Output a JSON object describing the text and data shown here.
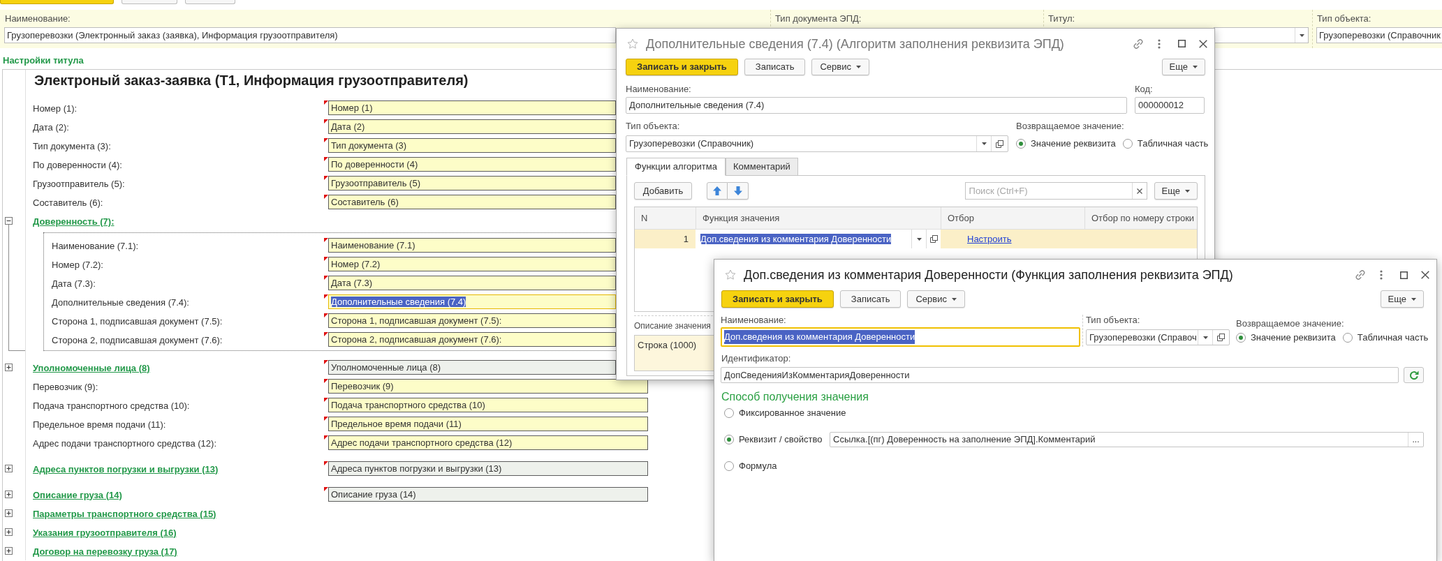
{
  "toolbar": {
    "buttons": [
      {
        "kind": "primary"
      },
      {
        "kind": "default"
      },
      {
        "kind": "default"
      }
    ]
  },
  "header": {
    "fields": [
      {
        "label": "Наименование:",
        "kind": "text",
        "value": "Грузоперевозки (Электронный заказ (заявка), Информация грузоотправителя)"
      },
      {
        "label": "Тип документа ЭПД:"
      },
      {
        "label": "Титул:",
        "kind": "dropdown"
      },
      {
        "label": "Тип объекта:",
        "kind": "text",
        "value": "Грузоперевозки (Справочник"
      }
    ]
  },
  "title_settings": {
    "title": "Настройки титула",
    "heading": "Электроный заказ-заявка (Т1, Информация грузоотправителя)",
    "rows": [
      {
        "kind": "field",
        "label": "Номер (1):",
        "value": "Номер (1)"
      },
      {
        "kind": "field",
        "label": "Дата (2):",
        "value": "Дата (2)"
      },
      {
        "kind": "field",
        "label": "Тип документа (3):",
        "value": "Тип документа (3)"
      },
      {
        "kind": "field",
        "label": "По доверенности (4):",
        "value": "По доверенности (4)"
      },
      {
        "kind": "field",
        "label": "Грузоотправитель (5):",
        "value": "Грузоотправитель (5)"
      },
      {
        "kind": "field",
        "label": "Составитель (6):",
        "value": "Составитель (6)"
      },
      {
        "kind": "group",
        "label": "Доверенность (7):",
        "expanded": true,
        "children": [
          {
            "label": "Наименование (7.1):",
            "value": "Наименование (7.1)",
            "selected": false
          },
          {
            "label": "Номер (7.2):",
            "value": "Номер (7.2)",
            "selected": false
          },
          {
            "label": "Дата (7.3):",
            "value": "Дата (7.3)",
            "selected": false
          },
          {
            "label": "Дополнительные сведения (7.4):",
            "value": "Дополнительные сведения (7.4)",
            "selected": true
          },
          {
            "label": "Сторона 1, подписавшая документ (7.5):",
            "value": "Сторона 1, подписавшая документ (7.5):",
            "selected": false
          },
          {
            "label": "Сторона 2, подписавшая документ (7.6):",
            "value": "Сторона 2, подписавшая документ (7.6):",
            "selected": false
          }
        ]
      },
      {
        "kind": "group",
        "label": "Уполномоченные лица (8)",
        "expanded": false,
        "value": "Уполномоченные лица (8)"
      },
      {
        "kind": "field",
        "label": "Перевозчик (9):",
        "value": "Перевозчик (9)"
      },
      {
        "kind": "field",
        "label": "Подача транспортного средства (10):",
        "value": "Подача транспортного средства (10)"
      },
      {
        "kind": "field",
        "label": "Предельное время подачи (11):",
        "value": "Предельное время подачи (11)"
      },
      {
        "kind": "field",
        "label": "Адрес подачи транспортного средства (12):",
        "value": "Адрес подачи транспортного средства (12)"
      },
      {
        "kind": "group",
        "label": "Адреса пунктов погрузки и выгрузки (13)",
        "expanded": false,
        "value": "Адреса пунктов погрузки и выгрузки (13)"
      },
      {
        "kind": "group",
        "label": "Описание груза (14)",
        "expanded": false,
        "value": "Описание груза (14)"
      },
      {
        "kind": "group",
        "label": "Параметры транспортного средства (15)",
        "expanded": false
      },
      {
        "kind": "group",
        "label": "Указания грузоотправителя (16)",
        "expanded": false
      },
      {
        "kind": "group",
        "label": "Договор на перевозку груза (17)",
        "expanded": false
      }
    ]
  },
  "back_dialog": {
    "title": "Дополнительные сведения (7.4) (Алгоритм заполнения реквизита ЭПД)",
    "active": false,
    "buttons": [
      {
        "label": "Записать и закрыть",
        "kind": "primary"
      },
      {
        "label": "Записать",
        "kind": "default"
      },
      {
        "label": "Сервис",
        "kind": "menu"
      }
    ],
    "more_button": "Еще",
    "name_field": {
      "label": "Наименование:",
      "value": "Дополнительные сведения (7.4)"
    },
    "code_field": {
      "label": "Код:",
      "value": "000000012"
    },
    "object_type": {
      "label": "Тип объекта:",
      "value": "Грузоперевозки (Справочник)"
    },
    "return_value": {
      "label": "Возвращаемое значение:",
      "options": [
        {
          "label": "Значение реквизита",
          "selected": true
        },
        {
          "label": "Табличная часть",
          "selected": false
        }
      ]
    },
    "tabs": [
      {
        "label": "Функции алгоритма",
        "selected": true
      },
      {
        "label": "Комментарий",
        "selected": false
      }
    ],
    "table_toolbar": {
      "add_button": "Добавить",
      "search": {
        "placeholder": "Поиск (Ctrl+F)"
      },
      "more_button": "Еще"
    },
    "table": {
      "columns": [
        "N",
        "Функция значения",
        "Отбор",
        "Отбор по номеру строки"
      ],
      "rows": [
        {
          "n": "1",
          "function": "Доп.сведения из комментария Доверенности",
          "filter": "Настроить",
          "selected": true
        }
      ]
    },
    "description": {
      "label": "Описание значения",
      "value": "Строка (1000)"
    }
  },
  "front_dialog": {
    "title": "Доп.сведения из комментария Доверенности (Функция заполнения реквизита ЭПД)",
    "active": true,
    "buttons": [
      {
        "label": "Записать и закрыть",
        "kind": "primary"
      },
      {
        "label": "Записать",
        "kind": "default"
      },
      {
        "label": "Сервис",
        "kind": "menu"
      }
    ],
    "more_button": "Еще",
    "name_field": {
      "label": "Наименование:",
      "value": "Доп.сведения из комментария Доверенности",
      "focused": true
    },
    "object_type": {
      "label": "Тип объекта:",
      "value": "Грузоперевозки (Справоч"
    },
    "return_value": {
      "label": "Возвращаемое значение:",
      "options": [
        {
          "label": "Значение реквизита",
          "selected": true
        },
        {
          "label": "Табличная часть",
          "selected": false
        }
      ]
    },
    "identifier": {
      "label": "Идентификатор:",
      "value": "ДопСведенияИзКомментарияДоверенности"
    },
    "method": {
      "title": "Способ получения значения",
      "options": [
        {
          "label": "Фиксированное значение",
          "selected": false
        },
        {
          "label": "Реквизит / свойство",
          "selected": true,
          "value": "Ссылка.[(пг) Доверенность на заполнение ЭПД].Комментарий",
          "button": "..."
        },
        {
          "label": "Формула",
          "selected": false
        }
      ]
    }
  }
}
